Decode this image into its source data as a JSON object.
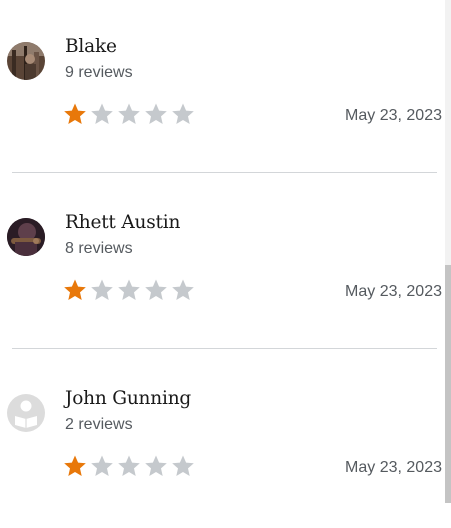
{
  "colors": {
    "star_filled": "#e8780a",
    "star_empty": "#c5c9cd",
    "divider": "#d3d6d9",
    "text_primary": "#1a1a1a",
    "text_secondary": "#555a5f"
  },
  "reviews": [
    {
      "name": "Blake",
      "review_count": "9 reviews",
      "rating": 1,
      "max_rating": 5,
      "date": "May 23, 2023",
      "avatar": "photo-avatar"
    },
    {
      "name": "Rhett Austin",
      "review_count": "8 reviews",
      "rating": 1,
      "max_rating": 5,
      "date": "May 23, 2023",
      "avatar": "photo-avatar"
    },
    {
      "name": "John Gunning",
      "review_count": "2 reviews",
      "rating": 1,
      "max_rating": 5,
      "date": "May 23, 2023",
      "avatar": "default-reader-avatar"
    }
  ]
}
